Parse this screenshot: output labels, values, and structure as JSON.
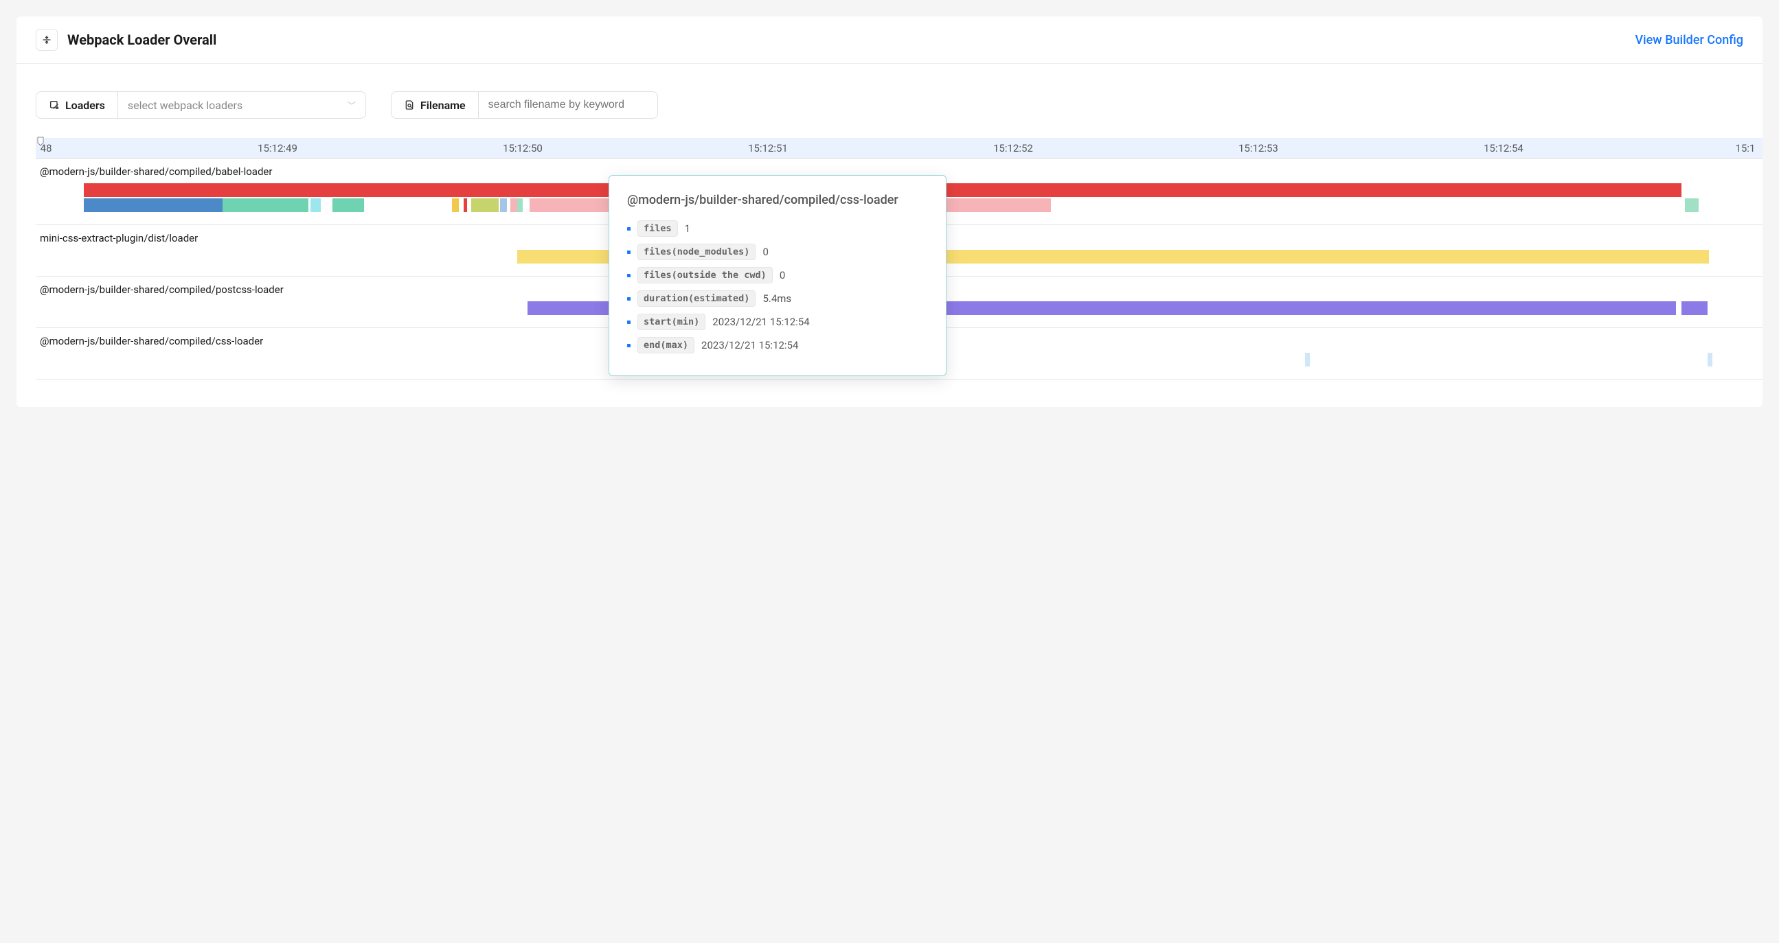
{
  "header": {
    "title": "Webpack Loader Overall",
    "linkLabel": "View Builder Config"
  },
  "filters": {
    "loaders": {
      "label": "Loaders",
      "placeholder": "select webpack loaders"
    },
    "filename": {
      "label": "Filename",
      "placeholder": "search filename by keyword"
    }
  },
  "ruler": {
    "ticks": [
      {
        "label": "48",
        "pct": 0.6
      },
      {
        "label": "15:12:49",
        "pct": 14.0
      },
      {
        "label": "15:12:50",
        "pct": 28.2
      },
      {
        "label": "15:12:51",
        "pct": 42.4
      },
      {
        "label": "15:12:52",
        "pct": 56.6
      },
      {
        "label": "15:12:53",
        "pct": 70.8
      },
      {
        "label": "15:12:54",
        "pct": 85.0
      },
      {
        "label": "15:1",
        "pct": 99.0
      }
    ]
  },
  "lanes": [
    {
      "label": "@modern-js/builder-shared/compiled/babel-loader",
      "tracks": [
        {
          "segments": [
            {
              "left": 2.8,
              "width": 92.5,
              "color": "#e5403f"
            }
          ]
        },
        {
          "segments": [
            {
              "left": 2.8,
              "width": 8.0,
              "color": "#4b89c8"
            },
            {
              "left": 10.8,
              "width": 5.0,
              "color": "#6fd3b1"
            },
            {
              "left": 15.9,
              "width": 0.6,
              "color": "#9ee6ed"
            },
            {
              "left": 17.2,
              "width": 1.8,
              "color": "#6fd3b1"
            },
            {
              "left": 24.1,
              "width": 0.4,
              "color": "#f2c94c"
            },
            {
              "left": 24.8,
              "width": 0.2,
              "color": "#e5403f"
            },
            {
              "left": 25.2,
              "width": 1.6,
              "color": "#c7d46b"
            },
            {
              "left": 26.9,
              "width": 0.4,
              "color": "#a6c4e5"
            },
            {
              "left": 27.5,
              "width": 0.4,
              "color": "#f6b4b8"
            },
            {
              "left": 27.9,
              "width": 0.3,
              "color": "#a0e1c6"
            },
            {
              "left": 28.6,
              "width": 11.5,
              "color": "#f6b4b8"
            },
            {
              "left": 40.6,
              "width": 18.2,
              "color": "#f6b4b8"
            },
            {
              "left": 95.5,
              "width": 0.8,
              "color": "#a0e1c6"
            }
          ]
        }
      ]
    },
    {
      "label": "mini-css-extract-plugin/dist/loader",
      "tracks": [
        {
          "segments": [
            {
              "left": 27.9,
              "width": 69.0,
              "color": "#f7dd72"
            }
          ]
        }
      ]
    },
    {
      "label": "@modern-js/builder-shared/compiled/postcss-loader",
      "tracks": [
        {
          "segments": [
            {
              "left": 28.5,
              "width": 66.5,
              "color": "#8c7ae6"
            },
            {
              "left": 95.3,
              "width": 1.5,
              "color": "#8c7ae6"
            }
          ]
        }
      ]
    },
    {
      "label": "@modern-js/builder-shared/compiled/css-loader",
      "tracks": [
        {
          "segments": [
            {
              "left": 73.5,
              "width": 0.3,
              "color": "#cfe7f7"
            },
            {
              "left": 96.8,
              "width": 0.3,
              "color": "#cfe7f7"
            }
          ]
        }
      ]
    }
  ],
  "tooltip": {
    "title": "@modern-js/builder-shared/compiled/css-loader",
    "rows": [
      {
        "key": "files",
        "value": "1"
      },
      {
        "key": "files(node_modules)",
        "value": "0"
      },
      {
        "key": "files(outside the cwd)",
        "value": "0"
      },
      {
        "key": "duration(estimated)",
        "value": "5.4ms"
      },
      {
        "key": "start(min)",
        "value": "2023/12/21 15:12:54"
      },
      {
        "key": "end(max)",
        "value": "2023/12/21 15:12:54"
      }
    ]
  },
  "chart_data": {
    "type": "timeline",
    "xaxis": {
      "unit": "time",
      "start": "15:12:48",
      "end": "15:12:55",
      "ticks": [
        "48",
        "15:12:49",
        "15:12:50",
        "15:12:51",
        "15:12:52",
        "15:12:53",
        "15:12:54",
        "15:1"
      ]
    },
    "series": [
      {
        "name": "@modern-js/builder-shared/compiled/babel-loader",
        "approx_start": "15:12:48.2",
        "approx_end": "15:12:54.8"
      },
      {
        "name": "mini-css-extract-plugin/dist/loader",
        "approx_start": "15:12:50.0",
        "approx_end": "15:12:54.8"
      },
      {
        "name": "@modern-js/builder-shared/compiled/postcss-loader",
        "approx_start": "15:12:50.0",
        "approx_end": "15:12:54.8"
      },
      {
        "name": "@modern-js/builder-shared/compiled/css-loader",
        "approx_start": "15:12:54",
        "approx_end": "15:12:54",
        "duration_ms": 5.4
      }
    ]
  }
}
